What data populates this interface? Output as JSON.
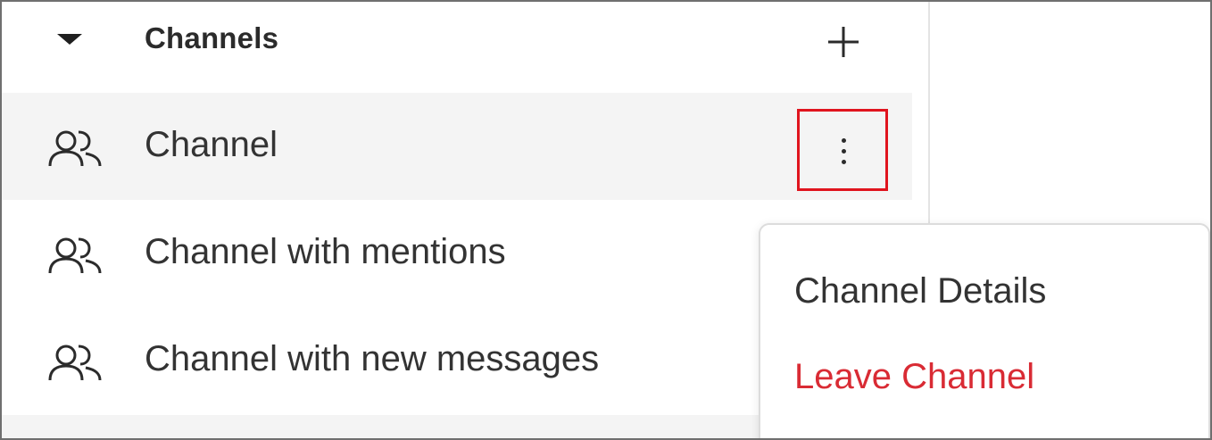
{
  "sidebar": {
    "section_title": "Channels",
    "channels": [
      {
        "label": "Channel",
        "active": true
      },
      {
        "label": "Channel with mentions",
        "active": false
      },
      {
        "label": "Channel with new messages",
        "active": false
      }
    ]
  },
  "context_menu": {
    "items": [
      {
        "label": "Channel Details",
        "color": "#333333"
      },
      {
        "label": "Leave Channel",
        "color": "#d92b34"
      }
    ]
  },
  "colors": {
    "highlight_border": "#e0141e",
    "active_row_bg": "#f4f4f4",
    "danger": "#d92b34"
  },
  "icons": {
    "collapse": "caret-down-icon",
    "add": "plus-icon",
    "channel": "people-icon",
    "more": "kebab-menu-icon"
  }
}
